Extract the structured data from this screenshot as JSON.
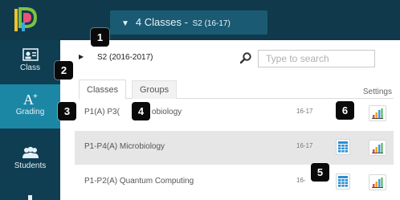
{
  "header": {
    "selector_label": "4 Classes",
    "selector_separator": "-",
    "selector_term": "S2 (16-17)"
  },
  "sidebar": {
    "items": [
      {
        "id": "class",
        "label": "Class",
        "icon": "id-card-icon"
      },
      {
        "id": "grading",
        "label": "Grading",
        "icon": "grade-a-plus-icon",
        "active": true
      },
      {
        "id": "students",
        "label": "Students",
        "icon": "people-icon"
      }
    ]
  },
  "term": {
    "label": "S2 (2016-2017)"
  },
  "search": {
    "placeholder": "Type to search"
  },
  "tabs": [
    {
      "label": "Classes",
      "active": true
    },
    {
      "label": "Groups",
      "active": false
    }
  ],
  "settings_label": "Settings",
  "classes": [
    {
      "name": "P1(A) P3(",
      "name_suffix": "obiology",
      "year": "16-17"
    },
    {
      "name": "P1-P4(A) Microbiology",
      "year": "16-17"
    },
    {
      "name": "P1-P2(A) Quantum Computing",
      "year": "16-"
    }
  ],
  "callouts": [
    "1",
    "2",
    "3",
    "4",
    "6",
    "5"
  ],
  "colors": {
    "topbar": "#103a4c",
    "sidebar": "#0f3d52",
    "active_nav": "#1c86a5",
    "selector": "#1b5a73",
    "grid_icon": "#2a8fd1",
    "selected_row": "#e6e6e6"
  }
}
